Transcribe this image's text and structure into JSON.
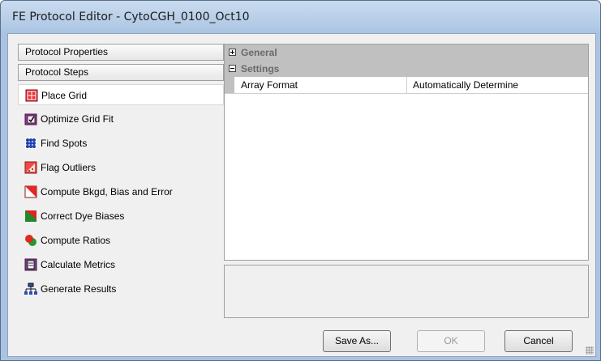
{
  "window": {
    "title": "FE Protocol Editor - CytoCGH_0100_Oct10"
  },
  "left_panel": {
    "properties_header": "Protocol Properties",
    "steps_header": "Protocol Steps",
    "steps": [
      {
        "label": "Place Grid",
        "icon": "place-grid-icon",
        "selected": true
      },
      {
        "label": "Optimize Grid Fit",
        "icon": "optimize-grid-icon"
      },
      {
        "label": "Find Spots",
        "icon": "find-spots-icon"
      },
      {
        "label": "Flag Outliers",
        "icon": "flag-outliers-icon"
      },
      {
        "label": "Compute Bkgd, Bias and Error",
        "icon": "compute-bkgd-icon"
      },
      {
        "label": "Correct Dye Biases",
        "icon": "correct-dye-icon"
      },
      {
        "label": "Compute Ratios",
        "icon": "compute-ratios-icon"
      },
      {
        "label": "Calculate Metrics",
        "icon": "calculate-metrics-icon"
      },
      {
        "label": "Generate Results",
        "icon": "generate-results-icon"
      }
    ]
  },
  "property_grid": {
    "categories": [
      {
        "label": "General",
        "expanded": false
      },
      {
        "label": "Settings",
        "expanded": true
      }
    ],
    "properties": [
      {
        "name": "Array Format",
        "value": "Automatically Determine"
      }
    ]
  },
  "buttons": {
    "save_as": "Save As...",
    "ok": "OK",
    "cancel": "Cancel"
  }
}
